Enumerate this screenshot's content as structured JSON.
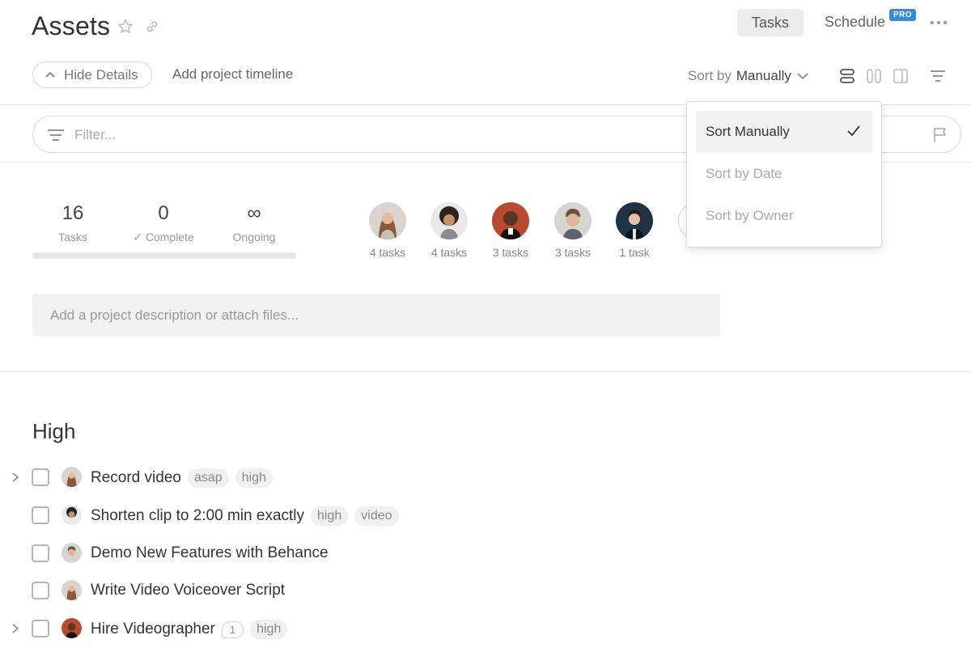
{
  "header": {
    "title": "Assets",
    "tabs": {
      "tasks": "Tasks",
      "schedule": "Schedule",
      "pro_badge": "PRO"
    },
    "hide_details": "Hide Details",
    "add_timeline": "Add project timeline",
    "sort_prefix": "Sort by",
    "sort_value": "Manually"
  },
  "filter": {
    "placeholder": "Filter..."
  },
  "stats": {
    "tasks": {
      "value": "16",
      "label": "Tasks"
    },
    "complete": {
      "value": "0",
      "label": "Complete"
    },
    "ongoing": {
      "value": "∞",
      "label": "Ongoing"
    },
    "progress_fraction": 0
  },
  "members": [
    {
      "count": "4 tasks"
    },
    {
      "count": "4 tasks"
    },
    {
      "count": "3 tasks"
    },
    {
      "count": "3 tasks"
    },
    {
      "count": "1 task"
    }
  ],
  "description": {
    "placeholder": "Add a project description or attach files..."
  },
  "section": {
    "title": "High",
    "tasks": [
      {
        "name": "Record video",
        "tags": [
          "asap",
          "high"
        ]
      },
      {
        "name": "Shorten clip to 2:00 min exactly",
        "tags": [
          "high",
          "video"
        ]
      },
      {
        "name": "Demo New Features with Behance",
        "tags": []
      },
      {
        "name": "Write Video Voiceover Script",
        "tags": []
      },
      {
        "name": "Hire Videographer",
        "comments": "1",
        "tags": [
          "high"
        ]
      }
    ]
  },
  "sort_menu": {
    "items": [
      "Sort Manually",
      "Sort by Date",
      "Sort by Owner"
    ],
    "selected": "Sort Manually"
  },
  "colors": {
    "accent": "#2f8ce4",
    "progress": "#7ac27a"
  }
}
